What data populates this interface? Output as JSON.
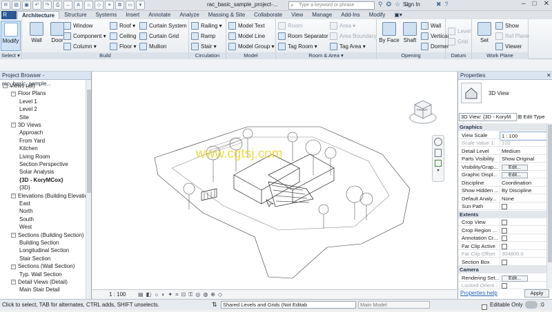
{
  "title_bar": {
    "doc_title": "rac_basic_sample_project-...",
    "search_placeholder": "Type a keyword or phrase",
    "sign_in": "Sign In",
    "window_controls": [
      "–",
      "□",
      "✕"
    ]
  },
  "tabs": [
    "Architecture",
    "Structure",
    "Systems",
    "Insert",
    "Annotate",
    "Analyze",
    "Massing & Site",
    "Collaborate",
    "View",
    "Manage",
    "Add-Ins",
    "Modify"
  ],
  "ribbon": {
    "select": {
      "modify": "Modify",
      "label": "Select ▾"
    },
    "build": {
      "label": "Build",
      "wall": "Wall",
      "door": "Door",
      "col1": [
        "Window",
        "Component ▾",
        "Column ▾"
      ],
      "col2": [
        "Roof ▾",
        "Ceiling",
        "Floor ▾"
      ],
      "col3": [
        "Curtain System",
        "Curtain Grid",
        "Mullion"
      ]
    },
    "circulation": {
      "label": "Circulation",
      "items": [
        "Railing ▾",
        "Ramp",
        "Stair ▾"
      ]
    },
    "model": {
      "label": "Model",
      "items": [
        "Model Text",
        "Model Line",
        "Model Group ▾"
      ]
    },
    "room_area": {
      "label": "Room & Area ▾",
      "col1": [
        "Room",
        "Room Separator",
        "Tag Room ▾"
      ],
      "col2": [
        "Area ▾",
        "Area Boundary",
        "Tag Area ▾"
      ]
    },
    "opening": {
      "label": "Opening",
      "by_face": "By Face",
      "shaft": "Shaft",
      "items": [
        "Wall",
        "Vertical",
        "Dormer"
      ]
    },
    "datum": {
      "label": "Datum",
      "items": [
        "Level",
        "Grid"
      ]
    },
    "work_plane": {
      "label": "Work Plane",
      "set": "Set",
      "items": [
        "Show",
        "Ref Plane",
        "Viewer"
      ]
    }
  },
  "project_browser": {
    "title": "Project Browser - rac_basic_sample...",
    "items": [
      {
        "label": "Views (all)",
        "indent": 0,
        "toggle": "−"
      },
      {
        "label": "Floor Plans",
        "indent": 1,
        "toggle": "−"
      },
      {
        "label": "Level 1",
        "indent": 2,
        "toggle": ""
      },
      {
        "label": "Level 2",
        "indent": 2,
        "toggle": ""
      },
      {
        "label": "Site",
        "indent": 2,
        "toggle": ""
      },
      {
        "label": "3D Views",
        "indent": 1,
        "toggle": "−"
      },
      {
        "label": "Approach",
        "indent": 2,
        "toggle": ""
      },
      {
        "label": "From Yard",
        "indent": 2,
        "toggle": ""
      },
      {
        "label": "Kitchen",
        "indent": 2,
        "toggle": ""
      },
      {
        "label": "Living Room",
        "indent": 2,
        "toggle": ""
      },
      {
        "label": "Section Perspective",
        "indent": 2,
        "toggle": ""
      },
      {
        "label": "Solar Analysis",
        "indent": 2,
        "toggle": ""
      },
      {
        "label": "{3D - KoryMCox}",
        "indent": 2,
        "toggle": "",
        "bold": true
      },
      {
        "label": "{3D}",
        "indent": 2,
        "toggle": ""
      },
      {
        "label": "Elevations (Building Elevation)",
        "indent": 1,
        "toggle": "−"
      },
      {
        "label": "East",
        "indent": 2,
        "toggle": ""
      },
      {
        "label": "North",
        "indent": 2,
        "toggle": ""
      },
      {
        "label": "South",
        "indent": 2,
        "toggle": ""
      },
      {
        "label": "West",
        "indent": 2,
        "toggle": ""
      },
      {
        "label": "Sections (Building Section)",
        "indent": 1,
        "toggle": "−"
      },
      {
        "label": "Building Section",
        "indent": 2,
        "toggle": ""
      },
      {
        "label": "Longitudinal Section",
        "indent": 2,
        "toggle": ""
      },
      {
        "label": "Stair Section",
        "indent": 2,
        "toggle": ""
      },
      {
        "label": "Sections (Wall Section)",
        "indent": 1,
        "toggle": "−"
      },
      {
        "label": "Typ. Wall Section",
        "indent": 2,
        "toggle": ""
      },
      {
        "label": "Detail Views (Detail)",
        "indent": 1,
        "toggle": "−"
      },
      {
        "label": "Main Stair Detail",
        "indent": 2,
        "toggle": ""
      }
    ]
  },
  "viewport": {
    "watermark": "www.cgtsj.com",
    "viewcube_face": "FRONT",
    "scale": "1 : 100"
  },
  "properties": {
    "title": "Properties",
    "type_name": "3D View",
    "selector": "3D View: {3D - KoryM",
    "edit_type": "Edit Type",
    "groups": [
      {
        "name": "Graphics",
        "rows": [
          {
            "k": "View Scale",
            "v": "1 : 100",
            "input": true
          },
          {
            "k": "Scale Value    1:",
            "v": "100",
            "dim": true
          },
          {
            "k": "Detail Level",
            "v": "Medium"
          },
          {
            "k": "Parts Visibility",
            "v": "Show Original"
          },
          {
            "k": "Visibility/Grap...",
            "v": "Edit...",
            "btn": true
          },
          {
            "k": "Graphic Displ...",
            "v": "Edit...",
            "btn": true
          },
          {
            "k": "Discipline",
            "v": "Coordination"
          },
          {
            "k": "Show Hidden ...",
            "v": "By Discipline"
          },
          {
            "k": "Default Analy...",
            "v": "None"
          },
          {
            "k": "Sun Path",
            "v": "",
            "chk": true
          }
        ]
      },
      {
        "name": "Extents",
        "rows": [
          {
            "k": "Crop View",
            "v": "",
            "chk": true
          },
          {
            "k": "Crop Region ...",
            "v": "",
            "chk": true
          },
          {
            "k": "Annotation Cr...",
            "v": "",
            "chk": true
          },
          {
            "k": "Far Clip Active",
            "v": "",
            "chk": true
          },
          {
            "k": "Far Clip Offset",
            "v": "304800.0",
            "dim": true
          },
          {
            "k": "Section Box",
            "v": "",
            "chk": true
          }
        ]
      },
      {
        "name": "Camera",
        "rows": [
          {
            "k": "Rendering Set...",
            "v": "Edit...",
            "btn": true
          },
          {
            "k": "Locked Orient...",
            "v": "",
            "chk": true,
            "dim": true
          }
        ]
      }
    ],
    "help": "Properties help",
    "apply": "Apply"
  },
  "status": {
    "hint": "Click to select, TAB for alternates, CTRL adds, SHIFT unselects.",
    "workset": "Shared Levels and Grids (Not Editab",
    "model": "Main Model",
    "editable_only": "Editable Only",
    "zero": ":0"
  }
}
